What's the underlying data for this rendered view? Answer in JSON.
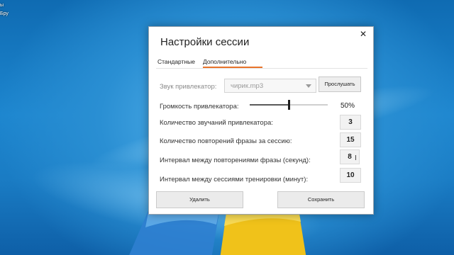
{
  "desktop": {
    "icon_label_lines": [
      "ы",
      "Бру"
    ]
  },
  "dialog": {
    "title": "Настройки сессии",
    "close_glyph": "✕",
    "tabs": [
      {
        "label": "Стандартные",
        "active": false
      },
      {
        "label": "Дополнительно",
        "active": true
      }
    ],
    "accent_color": "#e8742b",
    "sound": {
      "label": "Звук привлекатор:",
      "selected": "чирик.mp3",
      "listen_button": "Прослушать"
    },
    "volume": {
      "label": "Громкость привлекатора:",
      "value_text": "50%",
      "level": 0.5
    },
    "fields": {
      "count": {
        "label": "Количество звучаний привлекатора:",
        "value": "3"
      },
      "repeats": {
        "label": "Количество повторений фразы за сессию:",
        "value": "15"
      },
      "interval_phrase": {
        "label": "Интервал между повторениями фразы (секунд):",
        "value": "8"
      },
      "interval_session": {
        "label": "Интервал между сессиями тренировки (минут):",
        "value": "10"
      }
    },
    "buttons": {
      "delete": "Удалить",
      "save": "Сохранить"
    }
  }
}
